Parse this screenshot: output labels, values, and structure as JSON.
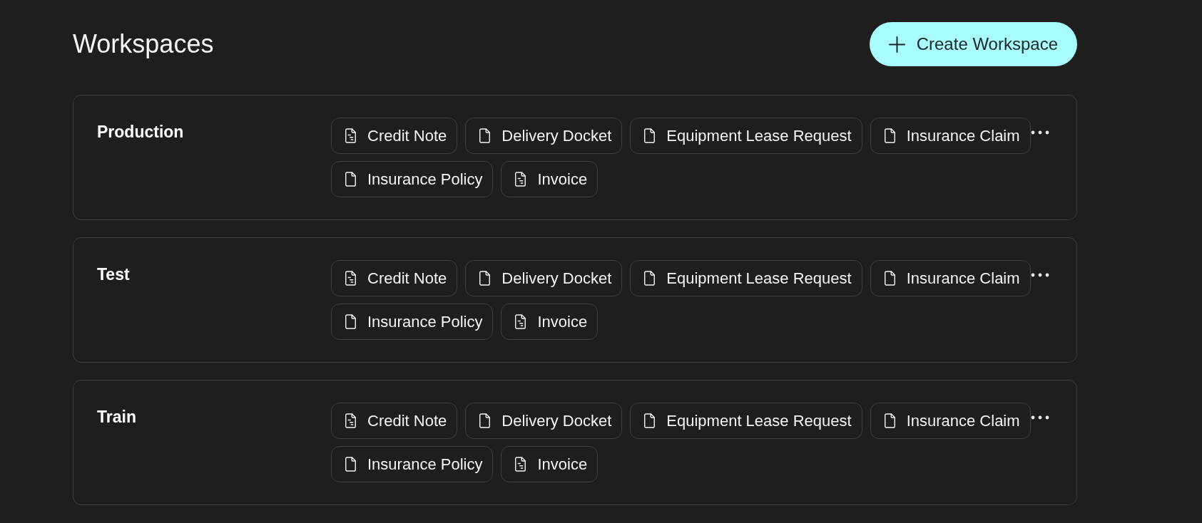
{
  "page": {
    "title": "Workspaces"
  },
  "create_button": {
    "label": "Create Workspace"
  },
  "workspaces": [
    {
      "name": "Production",
      "document_types": [
        {
          "label": "Credit Note",
          "kind": "lined"
        },
        {
          "label": "Delivery Docket",
          "kind": "blank"
        },
        {
          "label": "Equipment Lease Request",
          "kind": "blank"
        },
        {
          "label": "Insurance Claim",
          "kind": "blank"
        },
        {
          "label": "Insurance Policy",
          "kind": "blank"
        },
        {
          "label": "Invoice",
          "kind": "lined"
        }
      ]
    },
    {
      "name": "Test",
      "document_types": [
        {
          "label": "Credit Note",
          "kind": "lined"
        },
        {
          "label": "Delivery Docket",
          "kind": "blank"
        },
        {
          "label": "Equipment Lease Request",
          "kind": "blank"
        },
        {
          "label": "Insurance Claim",
          "kind": "blank"
        },
        {
          "label": "Insurance Policy",
          "kind": "blank"
        },
        {
          "label": "Invoice",
          "kind": "lined"
        }
      ]
    },
    {
      "name": "Train",
      "document_types": [
        {
          "label": "Credit Note",
          "kind": "lined"
        },
        {
          "label": "Delivery Docket",
          "kind": "blank"
        },
        {
          "label": "Equipment Lease Request",
          "kind": "blank"
        },
        {
          "label": "Insurance Claim",
          "kind": "blank"
        },
        {
          "label": "Insurance Policy",
          "kind": "blank"
        },
        {
          "label": "Invoice",
          "kind": "lined"
        }
      ]
    }
  ]
}
